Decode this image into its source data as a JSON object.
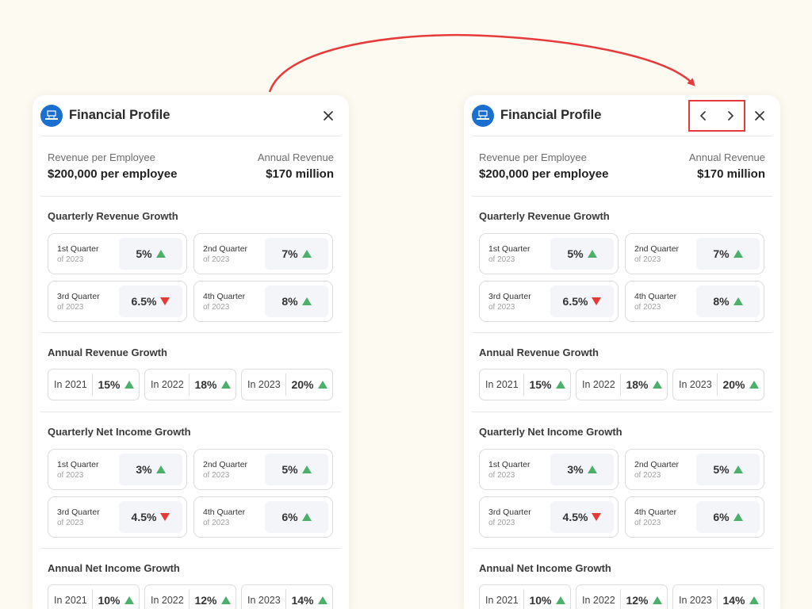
{
  "colors": {
    "background": "#fdfaf2",
    "accent_red": "#e53b3b",
    "up": "#4caf6a",
    "down": "#e53935",
    "logo": "#1b6fcf"
  },
  "panels": [
    {
      "title": "Financial Profile",
      "logo_icon": "company-logo",
      "show_nav": false,
      "close_icon": "close-icon",
      "summary": {
        "left_label": "Revenue per Employee",
        "left_value": "$200,000 per employee",
        "right_label": "Annual Revenue",
        "right_value": "$170 million"
      },
      "quarterly_revenue": {
        "title": "Quarterly Revenue Growth",
        "items": [
          {
            "name": "1st Quarter",
            "sub": "of 2023",
            "value": "5%",
            "trend": "up"
          },
          {
            "name": "2nd Quarter",
            "sub": "of 2023",
            "value": "7%",
            "trend": "up"
          },
          {
            "name": "3rd Quarter",
            "sub": "of 2023",
            "value": "6.5%",
            "trend": "down"
          },
          {
            "name": "4th Quarter",
            "sub": "of 2023",
            "value": "8%",
            "trend": "up"
          }
        ]
      },
      "annual_revenue": {
        "title": "Annual Revenue Growth",
        "items": [
          {
            "year": "In 2021",
            "value": "15%",
            "trend": "up"
          },
          {
            "year": "In 2022",
            "value": "18%",
            "trend": "up"
          },
          {
            "year": "In 2023",
            "value": "20%",
            "trend": "up"
          }
        ]
      },
      "quarterly_net_income": {
        "title": "Quarterly Net Income Growth",
        "items": [
          {
            "name": "1st Quarter",
            "sub": "of 2023",
            "value": "3%",
            "trend": "up"
          },
          {
            "name": "2nd Quarter",
            "sub": "of 2023",
            "value": "5%",
            "trend": "up"
          },
          {
            "name": "3rd Quarter",
            "sub": "of 2023",
            "value": "4.5%",
            "trend": "down"
          },
          {
            "name": "4th Quarter",
            "sub": "of 2023",
            "value": "6%",
            "trend": "up"
          }
        ]
      },
      "annual_net_income": {
        "title": "Annual Net Income Growth",
        "items": [
          {
            "year": "In 2021",
            "value": "10%",
            "trend": "up"
          },
          {
            "year": "In 2022",
            "value": "12%",
            "trend": "up"
          },
          {
            "year": "In 2023",
            "value": "14%",
            "trend": "up"
          }
        ]
      }
    },
    {
      "title": "Financial Profile",
      "logo_icon": "company-logo",
      "show_nav": true,
      "prev_icon": "chevron-left-icon",
      "next_icon": "chevron-right-icon",
      "close_icon": "close-icon",
      "summary": {
        "left_label": "Revenue per Employee",
        "left_value": "$200,000 per employee",
        "right_label": "Annual Revenue",
        "right_value": "$170 million"
      },
      "quarterly_revenue": {
        "title": "Quarterly Revenue Growth",
        "items": [
          {
            "name": "1st Quarter",
            "sub": "of 2023",
            "value": "5%",
            "trend": "up"
          },
          {
            "name": "2nd Quarter",
            "sub": "of 2023",
            "value": "7%",
            "trend": "up"
          },
          {
            "name": "3rd Quarter",
            "sub": "of 2023",
            "value": "6.5%",
            "trend": "down"
          },
          {
            "name": "4th Quarter",
            "sub": "of 2023",
            "value": "8%",
            "trend": "up"
          }
        ]
      },
      "annual_revenue": {
        "title": "Annual Revenue Growth",
        "items": [
          {
            "year": "In 2021",
            "value": "15%",
            "trend": "up"
          },
          {
            "year": "In 2022",
            "value": "18%",
            "trend": "up"
          },
          {
            "year": "In 2023",
            "value": "20%",
            "trend": "up"
          }
        ]
      },
      "quarterly_net_income": {
        "title": "Quarterly Net Income Growth",
        "items": [
          {
            "name": "1st Quarter",
            "sub": "of 2023",
            "value": "3%",
            "trend": "up"
          },
          {
            "name": "2nd Quarter",
            "sub": "of 2023",
            "value": "5%",
            "trend": "up"
          },
          {
            "name": "3rd Quarter",
            "sub": "of 2023",
            "value": "4.5%",
            "trend": "down"
          },
          {
            "name": "4th Quarter",
            "sub": "of 2023",
            "value": "6%",
            "trend": "up"
          }
        ]
      },
      "annual_net_income": {
        "title": "Annual Net Income Growth",
        "items": [
          {
            "year": "In 2021",
            "value": "10%",
            "trend": "up"
          },
          {
            "year": "In 2022",
            "value": "12%",
            "trend": "up"
          },
          {
            "year": "In 2023",
            "value": "14%",
            "trend": "up"
          }
        ]
      }
    }
  ]
}
